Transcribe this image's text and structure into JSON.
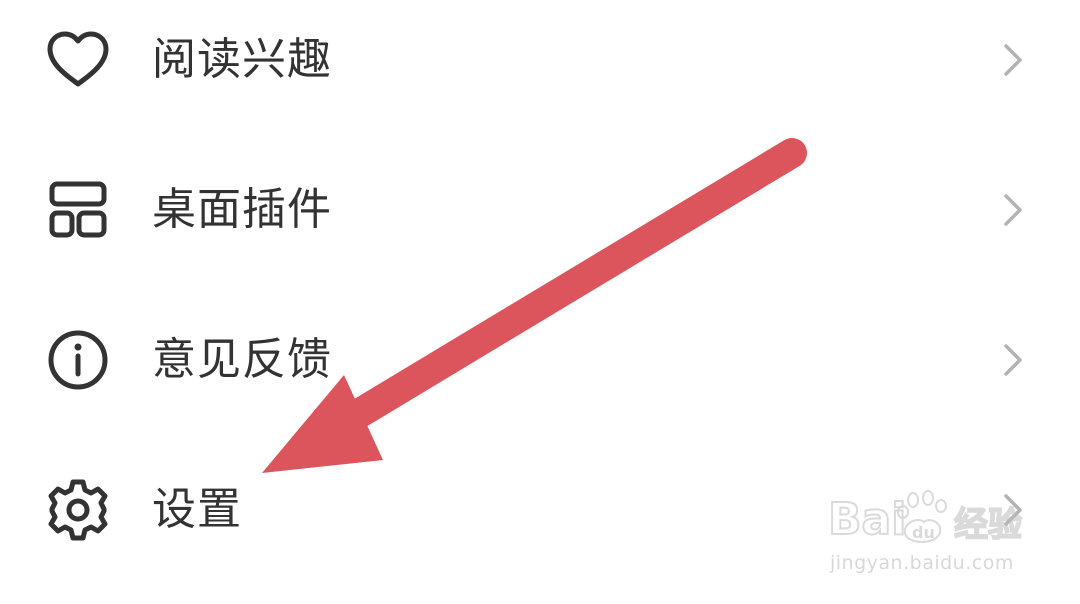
{
  "menu": {
    "items": [
      {
        "label": "阅读兴趣",
        "icon": "heart-icon"
      },
      {
        "label": "桌面插件",
        "icon": "widget-icon"
      },
      {
        "label": "意见反馈",
        "icon": "info-icon"
      },
      {
        "label": "设置",
        "icon": "gear-icon"
      }
    ]
  },
  "colors": {
    "text": "#333333",
    "icon": "#333333",
    "chevron": "#b3b3b3",
    "annotation_arrow": "#dc555c",
    "background": "#ffffff"
  },
  "watermark": {
    "brand": "Baidu经验",
    "url": "jingyan.baidu.com"
  }
}
